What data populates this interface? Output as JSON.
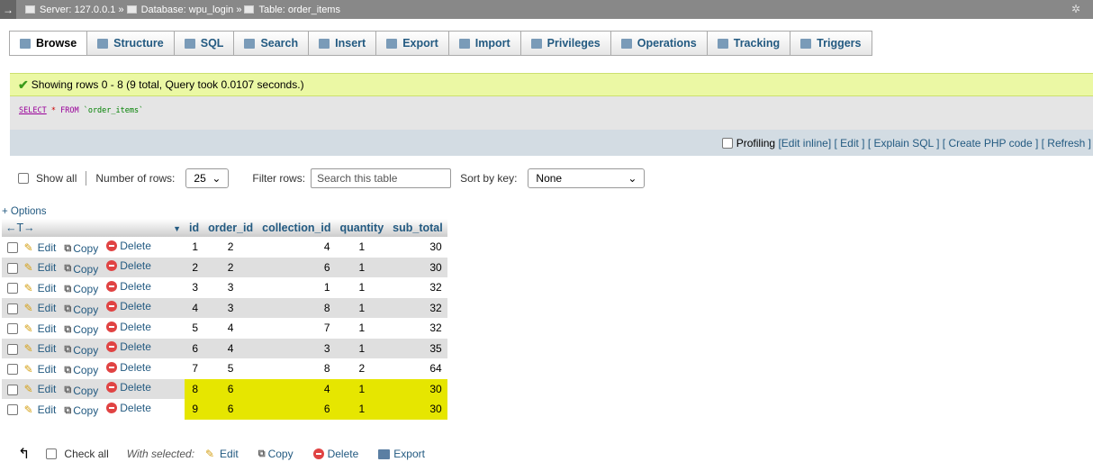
{
  "breadcrumb": {
    "back_icon": "arrow-right-icon",
    "server": "Server: 127.0.0.1 »",
    "database": "Database: wpu_login »",
    "table": "Table: order_items"
  },
  "tabs": [
    {
      "label": "Browse",
      "icon": "browse-icon",
      "active": true
    },
    {
      "label": "Structure",
      "icon": "structure-icon"
    },
    {
      "label": "SQL",
      "icon": "sql-icon"
    },
    {
      "label": "Search",
      "icon": "search-icon"
    },
    {
      "label": "Insert",
      "icon": "insert-icon"
    },
    {
      "label": "Export",
      "icon": "export-icon"
    },
    {
      "label": "Import",
      "icon": "import-icon"
    },
    {
      "label": "Privileges",
      "icon": "privileges-icon"
    },
    {
      "label": "Operations",
      "icon": "wrench-icon"
    },
    {
      "label": "Tracking",
      "icon": "eye-icon"
    },
    {
      "label": "Triggers",
      "icon": "triggers-icon"
    }
  ],
  "message": {
    "text": "Showing rows 0 - 8 (9 total, Query took 0.0107 seconds.)"
  },
  "sql": {
    "select": "SELECT",
    "star": "*",
    "from": "FROM",
    "table": "`order_items`"
  },
  "profiling": {
    "label": "Profiling",
    "links": [
      "[Edit inline]",
      "[ Edit ]",
      "[ Explain SQL ]",
      "[ Create PHP code ]",
      "[ Refresh ]"
    ]
  },
  "nav": {
    "show_all": "Show all",
    "rows_label": "Number of rows:",
    "rows_value": "25",
    "filter_label": "Filter rows:",
    "filter_placeholder": "Search this table",
    "sort_label": "Sort by key:",
    "sort_value": "None"
  },
  "options_label": "+ Options",
  "table": {
    "arrows": "←T→",
    "columns": [
      "id",
      "order_id",
      "collection_id",
      "quantity",
      "sub_total"
    ],
    "actions": {
      "edit": "Edit",
      "copy": "Copy",
      "delete": "Delete"
    },
    "rows": [
      {
        "id": "1",
        "order_id": "2",
        "collection_id": "4",
        "quantity": "1",
        "sub_total": "30"
      },
      {
        "id": "2",
        "order_id": "2",
        "collection_id": "6",
        "quantity": "1",
        "sub_total": "30"
      },
      {
        "id": "3",
        "order_id": "3",
        "collection_id": "1",
        "quantity": "1",
        "sub_total": "32"
      },
      {
        "id": "4",
        "order_id": "3",
        "collection_id": "8",
        "quantity": "1",
        "sub_total": "32"
      },
      {
        "id": "5",
        "order_id": "4",
        "collection_id": "7",
        "quantity": "1",
        "sub_total": "32"
      },
      {
        "id": "6",
        "order_id": "4",
        "collection_id": "3",
        "quantity": "1",
        "sub_total": "35"
      },
      {
        "id": "7",
        "order_id": "5",
        "collection_id": "8",
        "quantity": "2",
        "sub_total": "64"
      },
      {
        "id": "8",
        "order_id": "6",
        "collection_id": "4",
        "quantity": "1",
        "sub_total": "30",
        "highlighted": true
      },
      {
        "id": "9",
        "order_id": "6",
        "collection_id": "6",
        "quantity": "1",
        "sub_total": "30",
        "highlighted": true
      }
    ]
  },
  "footer": {
    "check_all": "Check all",
    "with_selected": "With selected:",
    "edit": "Edit",
    "copy": "Copy",
    "delete": "Delete",
    "export": "Export"
  },
  "colors": {
    "highlight": "#e6e600",
    "link": "#235a81",
    "success_bg": "#ebf8a4"
  }
}
